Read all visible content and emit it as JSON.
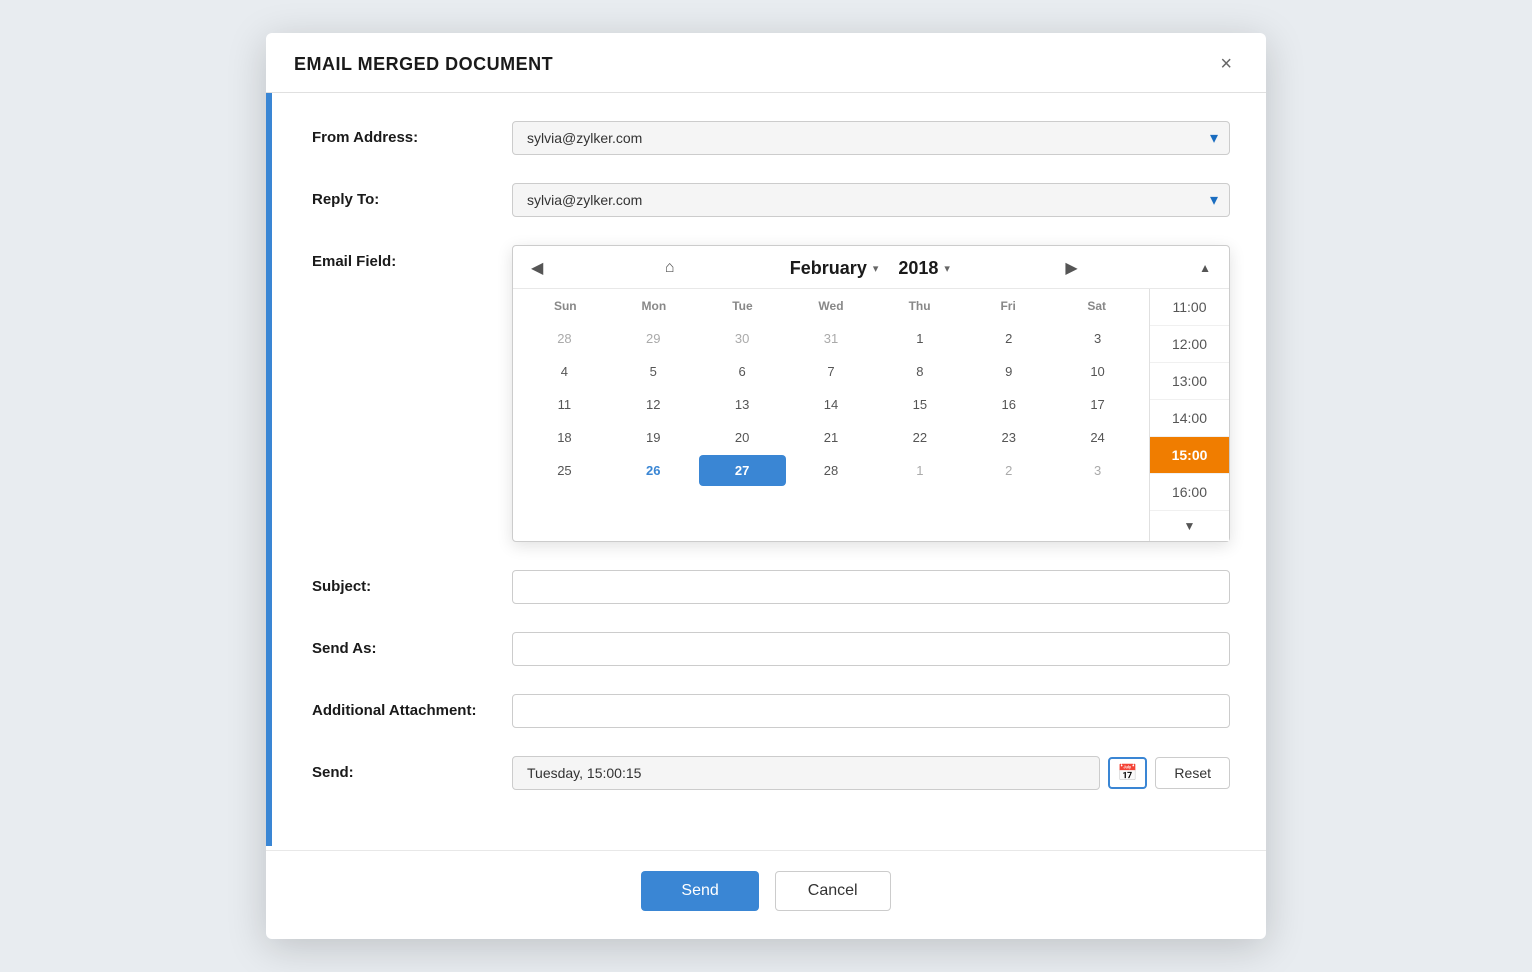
{
  "dialog": {
    "title": "EMAIL MERGED DOCUMENT",
    "close_label": "×"
  },
  "form": {
    "from_address_label": "From Address:",
    "from_address_value": "sylvia@zylker.com",
    "reply_to_label": "Reply To:",
    "reply_to_value": "sylvia@zylker.com",
    "email_field_label": "Email Field:",
    "subject_label": "Subject:",
    "send_as_label": "Send As:",
    "additional_attachment_label": "Additional Attachment:",
    "send_label": "Send:",
    "send_value": "Tuesday, 15:00:15"
  },
  "calendar": {
    "prev_label": "◀",
    "home_label": "⌂",
    "next_label": "▶",
    "month": "February",
    "month_arrow": "▾",
    "year": "2018",
    "year_arrow": "▾",
    "days_header": [
      "Sun",
      "Mon",
      "Tue",
      "Wed",
      "Thu",
      "Fri",
      "Sat"
    ],
    "weeks": [
      [
        {
          "day": "28",
          "type": "other"
        },
        {
          "day": "29",
          "type": "other"
        },
        {
          "day": "30",
          "type": "other"
        },
        {
          "day": "31",
          "type": "other"
        },
        {
          "day": "1",
          "type": "current"
        },
        {
          "day": "2",
          "type": "current"
        },
        {
          "day": "3",
          "type": "current"
        }
      ],
      [
        {
          "day": "4",
          "type": "current"
        },
        {
          "day": "5",
          "type": "current"
        },
        {
          "day": "6",
          "type": "current"
        },
        {
          "day": "7",
          "type": "current"
        },
        {
          "day": "8",
          "type": "current"
        },
        {
          "day": "9",
          "type": "current"
        },
        {
          "day": "10",
          "type": "current"
        }
      ],
      [
        {
          "day": "11",
          "type": "current"
        },
        {
          "day": "12",
          "type": "current"
        },
        {
          "day": "13",
          "type": "current"
        },
        {
          "day": "14",
          "type": "current"
        },
        {
          "day": "15",
          "type": "current"
        },
        {
          "day": "16",
          "type": "current"
        },
        {
          "day": "17",
          "type": "current"
        }
      ],
      [
        {
          "day": "18",
          "type": "current"
        },
        {
          "day": "19",
          "type": "current"
        },
        {
          "day": "20",
          "type": "current"
        },
        {
          "day": "21",
          "type": "current"
        },
        {
          "day": "22",
          "type": "current"
        },
        {
          "day": "23",
          "type": "current"
        },
        {
          "day": "24",
          "type": "current"
        }
      ],
      [
        {
          "day": "25",
          "type": "current"
        },
        {
          "day": "26",
          "type": "today"
        },
        {
          "day": "27",
          "type": "selected"
        },
        {
          "day": "28",
          "type": "current"
        },
        {
          "day": "1",
          "type": "other"
        },
        {
          "day": "2",
          "type": "other"
        },
        {
          "day": "3",
          "type": "other"
        }
      ]
    ],
    "times": [
      {
        "time": "11:00",
        "selected": false
      },
      {
        "time": "12:00",
        "selected": false
      },
      {
        "time": "13:00",
        "selected": false
      },
      {
        "time": "14:00",
        "selected": false
      },
      {
        "time": "15:00",
        "selected": true
      },
      {
        "time": "16:00",
        "selected": false
      }
    ],
    "scroll_up_label": "▲",
    "scroll_down_label": "▼",
    "calendar_icon": "📅",
    "reset_label": "Reset"
  },
  "footer": {
    "send_label": "Send",
    "cancel_label": "Cancel"
  }
}
